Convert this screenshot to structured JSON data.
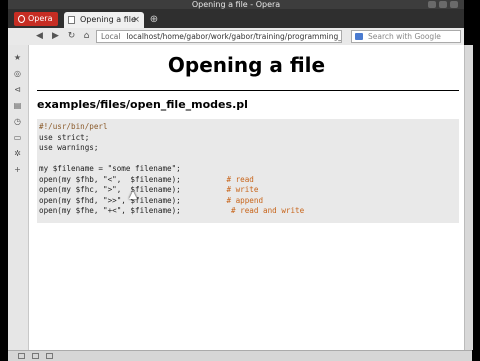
{
  "window": {
    "title": "Opening a file - Opera"
  },
  "browser": {
    "menu_label": "Opera",
    "tab_title": "Opening a file",
    "new_tab_symbol": "⊕",
    "address_prefix": "Local",
    "url": "localhost/home/gabor/work/gabor/training/programming_pe",
    "search_placeholder": "Search with Google"
  },
  "page": {
    "title": "Opening a file",
    "file_title": "examples/files/open_file_modes.pl"
  },
  "code": {
    "lines": [
      {
        "code": "#!/usr/bin/perl",
        "comment": ""
      },
      {
        "code": "use strict;",
        "comment": ""
      },
      {
        "code": "use warnings;",
        "comment": ""
      },
      {
        "code": "",
        "comment": ""
      },
      {
        "code": "my $filename = \"some filename\";",
        "comment": ""
      },
      {
        "code": "open(my $fhb, \"<\",  $filename);          ",
        "comment": "# read"
      },
      {
        "code": "open(my $fhc, \">\",  $filename);          ",
        "comment": "# write"
      },
      {
        "code": "open(my $fhd, \">>\", $filename);          ",
        "comment": "# append"
      },
      {
        "code": "open(my $fhe, \"+<\", $filename);          ",
        "comment": " # read and write"
      }
    ]
  },
  "icons": {
    "back": "back-arrow-icon",
    "forward": "forward-arrow-icon",
    "reload": "reload-icon",
    "home": "home-icon",
    "bookmarks": "star-icon"
  }
}
